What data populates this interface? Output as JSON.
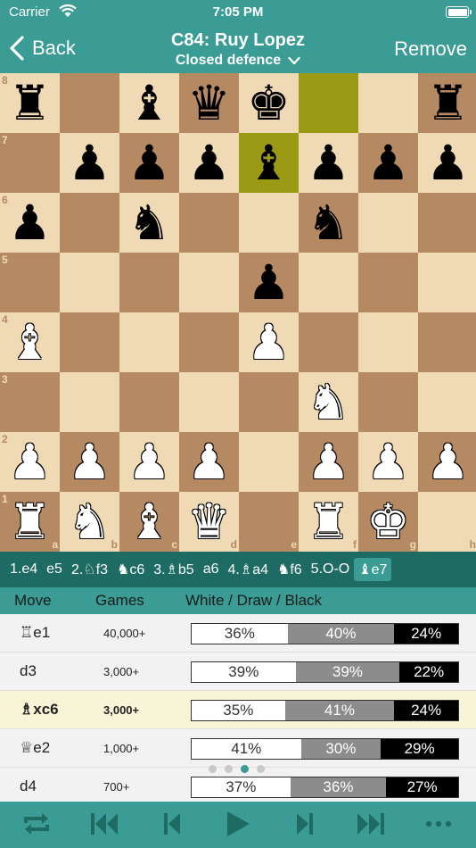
{
  "status": {
    "carrier": "Carrier",
    "time": "7:05 PM"
  },
  "nav": {
    "back_label": "Back",
    "title": "C84: Ruy Lopez",
    "subtitle": "Closed defence",
    "remove_label": "Remove"
  },
  "board": {
    "rank_labels": [
      "8",
      "7",
      "6",
      "5",
      "4",
      "3",
      "2",
      "1"
    ],
    "file_labels": [
      "a",
      "b",
      "c",
      "d",
      "e",
      "f",
      "g",
      "h"
    ],
    "highlighted_squares": [
      "f8",
      "e7"
    ],
    "pieces": [
      {
        "sq": "a8",
        "c": "b",
        "t": "r",
        "g": "♜"
      },
      {
        "sq": "c8",
        "c": "b",
        "t": "b",
        "g": "♝"
      },
      {
        "sq": "d8",
        "c": "b",
        "t": "q",
        "g": "♛"
      },
      {
        "sq": "e8",
        "c": "b",
        "t": "k",
        "g": "♚"
      },
      {
        "sq": "h8",
        "c": "b",
        "t": "r",
        "g": "♜"
      },
      {
        "sq": "b7",
        "c": "b",
        "t": "p",
        "g": "♟"
      },
      {
        "sq": "c7",
        "c": "b",
        "t": "p",
        "g": "♟"
      },
      {
        "sq": "d7",
        "c": "b",
        "t": "p",
        "g": "♟"
      },
      {
        "sq": "e7",
        "c": "b",
        "t": "b",
        "g": "♝"
      },
      {
        "sq": "f7",
        "c": "b",
        "t": "p",
        "g": "♟"
      },
      {
        "sq": "g7",
        "c": "b",
        "t": "p",
        "g": "♟"
      },
      {
        "sq": "h7",
        "c": "b",
        "t": "p",
        "g": "♟"
      },
      {
        "sq": "a6",
        "c": "b",
        "t": "p",
        "g": "♟"
      },
      {
        "sq": "c6",
        "c": "b",
        "t": "n",
        "g": "♞"
      },
      {
        "sq": "f6",
        "c": "b",
        "t": "n",
        "g": "♞"
      },
      {
        "sq": "e5",
        "c": "b",
        "t": "p",
        "g": "♟"
      },
      {
        "sq": "a4",
        "c": "w",
        "t": "b",
        "g": "♝"
      },
      {
        "sq": "e4",
        "c": "w",
        "t": "p",
        "g": "♟"
      },
      {
        "sq": "f3",
        "c": "w",
        "t": "n",
        "g": "♞"
      },
      {
        "sq": "a2",
        "c": "w",
        "t": "p",
        "g": "♟"
      },
      {
        "sq": "b2",
        "c": "w",
        "t": "p",
        "g": "♟"
      },
      {
        "sq": "c2",
        "c": "w",
        "t": "p",
        "g": "♟"
      },
      {
        "sq": "d2",
        "c": "w",
        "t": "p",
        "g": "♟"
      },
      {
        "sq": "f2",
        "c": "w",
        "t": "p",
        "g": "♟"
      },
      {
        "sq": "g2",
        "c": "w",
        "t": "p",
        "g": "♟"
      },
      {
        "sq": "h2",
        "c": "w",
        "t": "p",
        "g": "♟"
      },
      {
        "sq": "a1",
        "c": "w",
        "t": "r",
        "g": "♜"
      },
      {
        "sq": "b1",
        "c": "w",
        "t": "n",
        "g": "♞"
      },
      {
        "sq": "c1",
        "c": "w",
        "t": "b",
        "g": "♝"
      },
      {
        "sq": "d1",
        "c": "w",
        "t": "q",
        "g": "♛"
      },
      {
        "sq": "f1",
        "c": "w",
        "t": "r",
        "g": "♜"
      },
      {
        "sq": "g1",
        "c": "w",
        "t": "k",
        "g": "♚"
      }
    ]
  },
  "moves": [
    "1.e4",
    "e5",
    "2.♘f3",
    "♞c6",
    "3.♗b5",
    "a6",
    "4.♗a4",
    "♞f6",
    "5.O-O",
    "♝e7"
  ],
  "current_move_index": 9,
  "table": {
    "headers": {
      "move": "Move",
      "games": "Games",
      "result": "White / Draw / Black"
    },
    "rows": [
      {
        "move": "♖e1",
        "games": "40,000+",
        "white": "36%",
        "draw": "40%",
        "black": "24%",
        "w": 36,
        "d": 40,
        "b": 24,
        "selected": false
      },
      {
        "move": "d3",
        "games": "3,000+",
        "white": "39%",
        "draw": "39%",
        "black": "22%",
        "w": 39,
        "d": 39,
        "b": 22,
        "selected": false
      },
      {
        "move": "♗xc6",
        "games": "3,000+",
        "white": "35%",
        "draw": "41%",
        "black": "24%",
        "w": 35,
        "d": 41,
        "b": 24,
        "selected": true
      },
      {
        "move": "♕e2",
        "games": "1,000+",
        "white": "41%",
        "draw": "30%",
        "black": "29%",
        "w": 41,
        "d": 30,
        "b": 29,
        "selected": false
      },
      {
        "move": "d4",
        "games": "700+",
        "white": "37%",
        "draw": "36%",
        "black": "27%",
        "w": 37,
        "d": 36,
        "b": 27,
        "selected": false
      }
    ]
  },
  "page_dots": {
    "count": 4,
    "active": 2
  },
  "toolbar": [
    "flip-board-icon",
    "first-move-icon",
    "previous-move-icon",
    "play-icon",
    "next-move-icon",
    "last-move-icon",
    "more-icon"
  ],
  "colors": {
    "accent": "#3a9c94",
    "accent_dark": "#1e6b64",
    "light_square": "#efdab5",
    "dark_square": "#b58a63",
    "highlight": "#9a9a14"
  }
}
